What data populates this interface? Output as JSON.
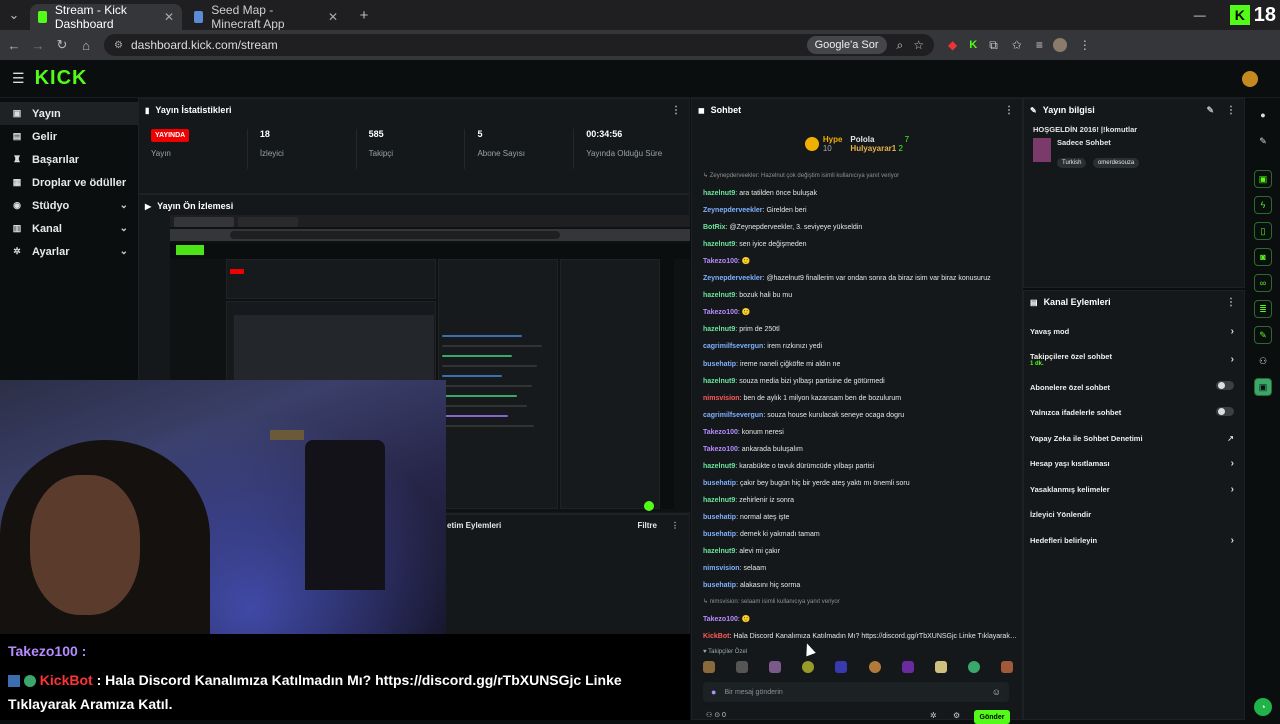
{
  "browser": {
    "tabs": [
      {
        "label": "Stream - Kick Dashboard",
        "active": true,
        "favicon_color": "#53fc18"
      },
      {
        "label": "Seed Map - Minecraft App",
        "active": false,
        "favicon_color": "#5b8bd6"
      }
    ],
    "new_tab": "+",
    "url": "dashboard.kick.com/stream",
    "google_ask": "Google'a Sor",
    "corner_count": "18"
  },
  "app": {
    "logo": "KICK"
  },
  "sidebar": {
    "items": [
      {
        "label": "Yayın",
        "icon": "broadcast-icon",
        "active": true,
        "chevron": false
      },
      {
        "label": "Gelir",
        "icon": "dollar-icon",
        "active": false,
        "chevron": false
      },
      {
        "label": "Başarılar",
        "icon": "trophy-icon",
        "active": false,
        "chevron": false
      },
      {
        "label": "Droplar ve ödüller",
        "icon": "gift-icon",
        "active": false,
        "chevron": false
      },
      {
        "label": "Stüdyo",
        "icon": "studio-icon",
        "active": false,
        "chevron": true
      },
      {
        "label": "Kanal",
        "icon": "channel-icon",
        "active": false,
        "chevron": true
      },
      {
        "label": "Ayarlar",
        "icon": "gear-icon",
        "active": false,
        "chevron": true
      }
    ]
  },
  "stats": {
    "title": "Yayın İstatistikleri",
    "items": [
      {
        "value": "YAYINDA",
        "label": "Yayın",
        "badge": true
      },
      {
        "value": "18",
        "label": "İzleyici"
      },
      {
        "value": "585",
        "label": "Takipçi"
      },
      {
        "value": "5",
        "label": "Abone Sayısı"
      },
      {
        "value": "00:34:56",
        "label": "Yayında Olduğu Süre"
      }
    ]
  },
  "preview": {
    "title": "Yayın Ön İzlemesi"
  },
  "moderation": {
    "title": "etim Eylemleri",
    "filter": "Filtre"
  },
  "chat": {
    "title": "Sohbet",
    "hype": {
      "label": "Hype",
      "count": "10"
    },
    "leaders": [
      {
        "name": "Polola",
        "count": "7"
      },
      {
        "name": "Hulyayarar1",
        "count": "2"
      }
    ],
    "messages": [
      {
        "kind": "sys",
        "text": "↳ Zeynepderveekler: Hazelnut çok değiştim isimli kullanıcıya yanıt veriyor"
      },
      {
        "user": "hazelnut9",
        "color": "u-green",
        "text": "ara tatilden önce buluşak"
      },
      {
        "user": "Zeynepderveekler",
        "color": "u-blue",
        "text": "Girelden beri"
      },
      {
        "user": "BotRix",
        "color": "u-green",
        "text": "@Zeynepderveekler, 3. seviyeye yükseldin"
      },
      {
        "user": "hazelnut9",
        "color": "u-green",
        "text": "sen iyice değişmeden"
      },
      {
        "user": "Takezo100",
        "color": "u-purple",
        "text": "🙂"
      },
      {
        "user": "Zeynepderveekler",
        "color": "u-blue",
        "text": "@hazelnut9 finallerim var ondan sonra da biraz isim var biraz konusuruz"
      },
      {
        "user": "hazelnut9",
        "color": "u-green",
        "text": "bozuk hali bu mu"
      },
      {
        "user": "Takezo100",
        "color": "u-purple",
        "text": "🙂"
      },
      {
        "user": "hazelnut9",
        "color": "u-green",
        "text": "prim de 250tl"
      },
      {
        "user": "cagrimilfsevergun",
        "color": "u-blue",
        "text": "irem rızkınızı yedi"
      },
      {
        "user": "busehatip",
        "color": "u-blue",
        "text": "ireme naneli çiğköfte mi aldın ne"
      },
      {
        "user": "hazelnut9",
        "color": "u-green",
        "text": "souza media bizi yılbaşı partisine de götürmedi"
      },
      {
        "user": "nimsvision",
        "color": "u-red",
        "text": "ben de aylık 1 milyon kazansam ben de bozulurum"
      },
      {
        "user": "cagrimilfsevergun",
        "color": "u-blue",
        "text": "souza house kurulacak seneye ocaga dogru"
      },
      {
        "user": "Takezo100",
        "color": "u-purple",
        "text": "konum neresi"
      },
      {
        "user": "Takezo100",
        "color": "u-purple",
        "text": "ankarada buluşalım"
      },
      {
        "user": "hazelnut9",
        "color": "u-green",
        "text": "karabükte o tavuk dürümcüde yılbaşı partisi"
      },
      {
        "user": "busehatip",
        "color": "u-blue",
        "text": "çakır bey bugün hiç bir yerde ateş yaktı mı önemli soru"
      },
      {
        "user": "hazelnut9",
        "color": "u-green",
        "text": "zehirlenir iz sonra"
      },
      {
        "user": "busehatip",
        "color": "u-blue",
        "text": "normal ateş işte"
      },
      {
        "user": "busehatip",
        "color": "u-blue",
        "text": "demek ki yakmadı tamam"
      },
      {
        "user": "hazelnut9",
        "color": "u-green",
        "text": "alevi mi çakır"
      },
      {
        "user": "nimsvision",
        "color": "u-blue",
        "text": "selaam"
      },
      {
        "user": "busehatip",
        "color": "u-blue",
        "text": "alakasını hiç sorma"
      },
      {
        "kind": "sys",
        "text": "↳ nimsvision: selaam isimli kullanıcıya yanıt veriyor"
      },
      {
        "user": "Takezo100",
        "color": "u-purple",
        "text": "🙂"
      },
      {
        "user": "KickBot",
        "color": "u-red",
        "text": "Hala Discord Kanalımıza Katılmadın Mı? https://discord.gg/rTbXUNSGjc Linke Tıklayarak Aramıza Katıl."
      }
    ],
    "follower_only_label": "Takipçiler Özel",
    "input_placeholder": "Bir mesaj gönderin",
    "send_label": "Gönder",
    "footer_count": "0"
  },
  "overlay": {
    "line1_user": "Takezo100",
    "line2_user": "KickBot",
    "line2_text": "Hala Discord Kanalımıza Katılmadın Mı? https://discord.gg/rTbXUNSGjc Linke",
    "line3_text": "Tıklayarak Aramıza Katıl."
  },
  "stream_info": {
    "title": "Yayın bilgisi",
    "stream_title": "HOŞGELDİN 2016! |!komutlar",
    "category": "Sadece Sohbet",
    "tags": [
      "Turkish",
      "omerdesouza"
    ]
  },
  "channel_actions": {
    "title": "Kanal Eylemleri",
    "items": [
      {
        "label": "Yavaş mod",
        "control": "chevron"
      },
      {
        "label": "Takipçilere özel sohbet",
        "sub": "1 dk.",
        "control": "chevron"
      },
      {
        "label": "Abonelere özel sohbet",
        "control": "toggle"
      },
      {
        "label": "Yalnızca ifadelerle sohbet",
        "control": "toggle"
      },
      {
        "label": "Yapay Zeka ile Sohbet Denetimi",
        "control": "external"
      },
      {
        "label": "Hesap yaşı kısıtlaması",
        "control": "chevron"
      },
      {
        "label": "Yasaklanmış kelimeler",
        "control": "chevron"
      },
      {
        "label": "İzleyici Yönlendir",
        "control": "none"
      },
      {
        "label": "Hedefleri belirleyin",
        "control": "chevron"
      }
    ]
  },
  "colors": {
    "brand": "#53fc18",
    "live": "#e00000",
    "background": "#0b0e0f"
  }
}
